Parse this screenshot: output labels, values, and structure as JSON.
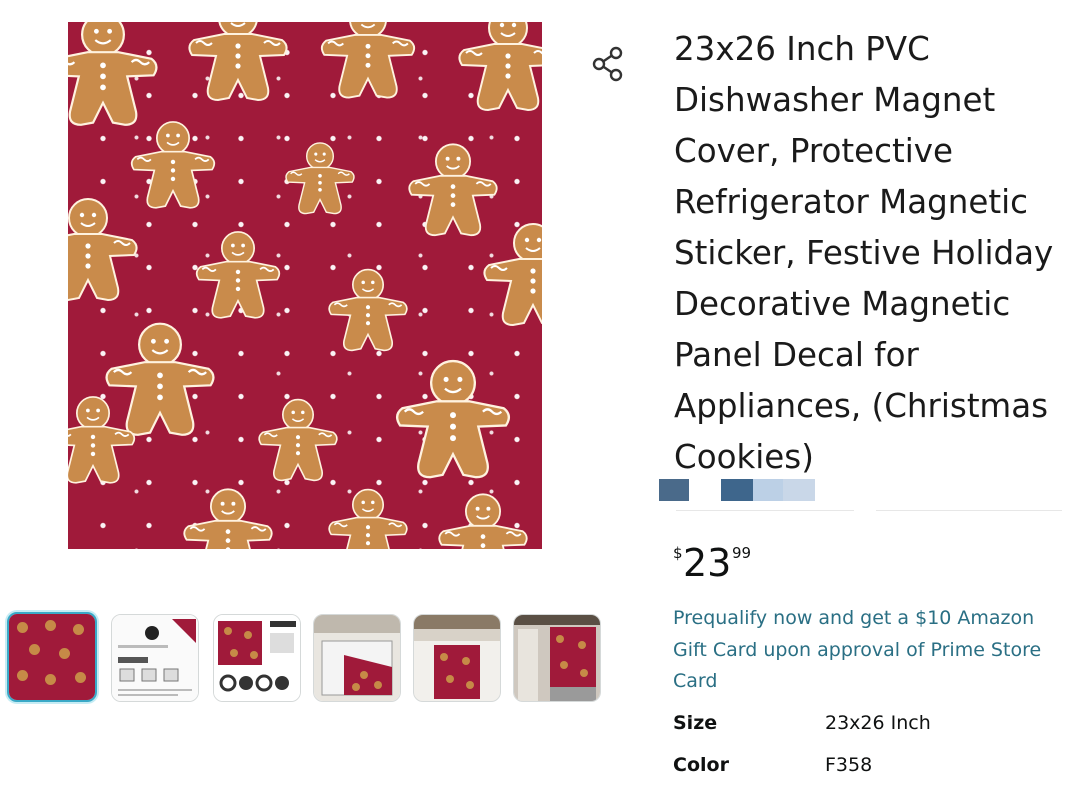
{
  "product": {
    "title": "23x26 Inch PVC Dishwasher Magnet Cover, Protective Refrigerator Magnetic Sticker, Festive Holiday Decorative Magnetic Panel Decal for Appliances, (Christmas Cookies)",
    "main_image_icon": "gingerbread-pattern-image"
  },
  "price": {
    "symbol": "$",
    "whole": "23",
    "fraction": "99"
  },
  "promo": {
    "text": "Prequalify now and get a $10 Amazon Gift Card upon approval of Prime Store Card"
  },
  "specs": [
    {
      "label": "Size",
      "value": "23x26 Inch"
    },
    {
      "label": "Color",
      "value": "F358"
    }
  ],
  "colors": {
    "main_image_bg": "#a01a3a",
    "cookie": "#c68a47",
    "promo_link": "#2a6f84",
    "thumb_selected_border": "#3aa9c7"
  },
  "thumbnails": [
    {
      "id": "pattern",
      "selected": true
    },
    {
      "id": "infographic",
      "selected": false
    },
    {
      "id": "size-chart",
      "selected": false
    },
    {
      "id": "dishwasher-open",
      "selected": false
    },
    {
      "id": "dishwasher-kitchen",
      "selected": false
    },
    {
      "id": "refrigerator",
      "selected": false
    }
  ]
}
